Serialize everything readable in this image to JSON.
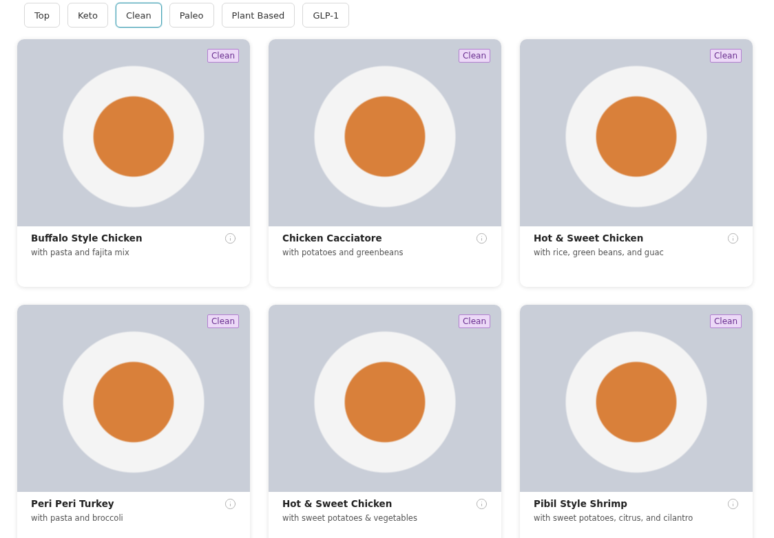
{
  "filters": [
    {
      "label": "Top",
      "selected": false
    },
    {
      "label": "Keto",
      "selected": false
    },
    {
      "label": "Clean",
      "selected": true
    },
    {
      "label": "Paleo",
      "selected": false
    },
    {
      "label": "Plant Based",
      "selected": false
    },
    {
      "label": "GLP-1",
      "selected": false
    }
  ],
  "meals": [
    {
      "badge": "Clean",
      "name": "Buffalo Style Chicken",
      "description": "with pasta and fajita mix"
    },
    {
      "badge": "Clean",
      "name": "Chicken Cacciatore",
      "description": "with potatoes and greenbeans"
    },
    {
      "badge": "Clean",
      "name": "Hot & Sweet Chicken",
      "description": "with rice, green beans, and guac"
    },
    {
      "badge": "Clean",
      "name": "Peri Peri Turkey",
      "description": "with pasta and broccoli"
    },
    {
      "badge": "Clean",
      "name": "Hot & Sweet Chicken",
      "description": "with sweet potatoes & vegetables"
    },
    {
      "badge": "Clean",
      "name": "Pibil Style Shrimp",
      "description": "with sweet potatoes, citrus, and cilantro"
    }
  ]
}
